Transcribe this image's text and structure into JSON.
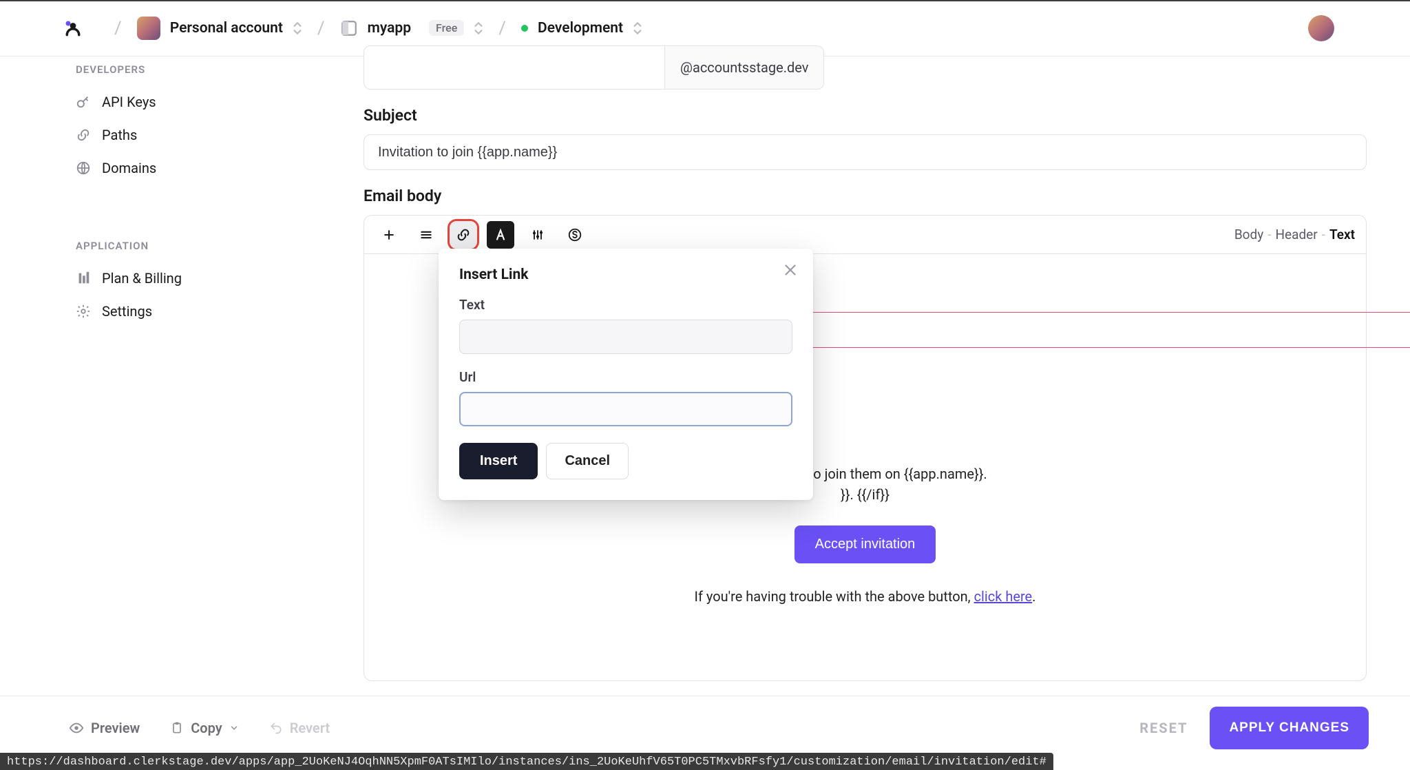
{
  "header": {
    "account_label": "Personal account",
    "app_name": "myapp",
    "app_tier": "Free",
    "env_name": "Development"
  },
  "sidebar": {
    "caption_dev": "DEVELOPERS",
    "caption_app": "APPLICATION",
    "items_dev": [
      {
        "label": "API Keys",
        "icon": "key-icon"
      },
      {
        "label": "Paths",
        "icon": "link-icon"
      },
      {
        "label": "Domains",
        "icon": "globe-icon"
      }
    ],
    "items_app": [
      {
        "label": "Plan & Billing",
        "icon": "billing-icon"
      },
      {
        "label": "Settings",
        "icon": "gear-icon"
      }
    ]
  },
  "form": {
    "from_domain": "@accountsstage.dev",
    "subject_label": "Subject",
    "subject_value": "Invitation to join {{app.name}}",
    "body_label": "Email body"
  },
  "editor": {
    "crumbs": {
      "a": "Body",
      "b": "Header",
      "c": "Text"
    }
  },
  "email": {
    "line1_tail": "nvited you to join them on {{app.name}}.",
    "line2_tail": "}}. {{/if}}",
    "accept_label": "Accept invitation",
    "trouble_prefix": "If you're having trouble with the above button, ",
    "trouble_link": "click here",
    "trouble_suffix": "."
  },
  "popup": {
    "title": "Insert Link",
    "text_label": "Text",
    "url_label": "Url",
    "insert_label": "Insert",
    "cancel_label": "Cancel"
  },
  "footer": {
    "preview": "Preview",
    "copy": "Copy",
    "revert": "Revert",
    "reset": "RESET",
    "apply": "APPLY CHANGES"
  },
  "status_url": "https://dashboard.clerkstage.dev/apps/app_2UoKeNJ4OqhNN5XpmF0ATsIMIlo/instances/ins_2UoKeUhfV65T0PC5TMxvbRFsfy1/customization/email/invitation/edit#"
}
